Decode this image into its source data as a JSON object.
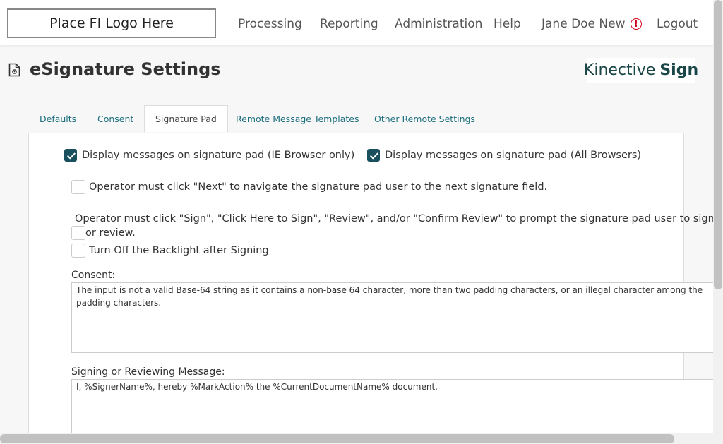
{
  "header": {
    "logo_text": "Place FI Logo Here",
    "nav": [
      {
        "label": "Processing"
      },
      {
        "label": "Reporting"
      },
      {
        "label": "Administration"
      },
      {
        "label": "Help"
      },
      {
        "label": "Jane Doe New"
      },
      {
        "label": "Logout"
      }
    ],
    "alert_icon": "!"
  },
  "page": {
    "title": "eSignature Settings",
    "brand_part1": "Kinective",
    "brand_part2": "Sign"
  },
  "tabs": [
    {
      "label": "Defaults"
    },
    {
      "label": "Consent"
    },
    {
      "label": "Signature Pad",
      "active": true
    },
    {
      "label": "Remote Message Templates"
    },
    {
      "label": "Other Remote Settings"
    }
  ],
  "settings": {
    "display_ie": {
      "label": "Display messages on signature pad (IE Browser only)",
      "checked": true
    },
    "display_all": {
      "label": "Display messages on signature pad (All Browsers)",
      "checked": true
    },
    "operator_next": {
      "label": "Operator must click \"Next\" to navigate the signature pad user to the next signature field.",
      "checked": false
    },
    "operator_sign": {
      "label_line1": "Operator must click \"Sign\", \"Click Here to Sign\", \"Review\", and/or \"Confirm Review\" to prompt the signature pad user to sign",
      "label_line2": "or review.",
      "checked": false
    },
    "backlight": {
      "label": "Turn Off the Backlight after Signing",
      "checked": false
    }
  },
  "consent": {
    "label": "Consent:",
    "value": "The input is not a valid Base-64 string as it contains a non-base 64 character, more than two padding characters, or an illegal character among the padding characters."
  },
  "signing_message": {
    "label": "Signing or Reviewing Message:",
    "value": "I, %SignerName%, hereby %MarkAction% the %CurrentDocumentName% document."
  },
  "colors": {
    "accent": "#1a4f5e",
    "tab_link": "#1c6e7d",
    "alert": "#d0021b",
    "brand": "#1a4647"
  },
  "icons": {
    "page_icon": "settings-document-icon",
    "alert": "alert-circle-icon"
  }
}
